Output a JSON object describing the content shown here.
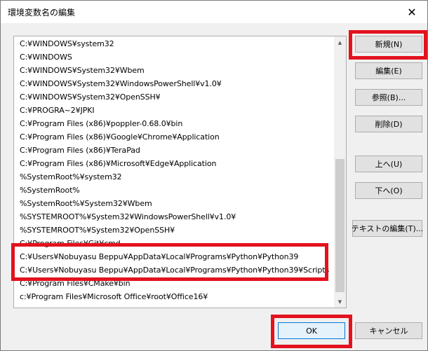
{
  "window": {
    "title": "環境変数名の編集",
    "close_label": "✕"
  },
  "list": {
    "items": [
      "C:¥WINDOWS¥system32",
      "C:¥WINDOWS",
      "C:¥WINDOWS¥System32¥Wbem",
      "C:¥WINDOWS¥System32¥WindowsPowerShell¥v1.0¥",
      "C:¥WINDOWS¥System32¥OpenSSH¥",
      "C:¥PROGRA~2¥JPKI",
      "C:¥Program Files (x86)¥poppler-0.68.0¥bin",
      "C:¥Program Files (x86)¥Google¥Chrome¥Application",
      "C:¥Program Files (x86)¥TeraPad",
      "C:¥Program Files (x86)¥Microsoft¥Edge¥Application",
      "%SystemRoot%¥system32",
      "%SystemRoot%",
      "%SystemRoot%¥System32¥Wbem",
      "%SYSTEMROOT%¥System32¥WindowsPowerShell¥v1.0¥",
      "%SYSTEMROOT%¥System32¥OpenSSH¥",
      "C:¥Program Files¥Git¥cmd",
      "C:¥Users¥Nobuyasu Beppu¥AppData¥Local¥Programs¥Python¥Python39",
      "C:¥Users¥Nobuyasu Beppu¥AppData¥Local¥Programs¥Python¥Python39¥Scripts",
      "C:¥Program Files¥CMake¥bin",
      "c:¥Program Files¥Microsoft Office¥root¥Office16¥"
    ]
  },
  "buttons": {
    "new": "新規(N)",
    "edit": "編集(E)",
    "browse": "参照(B)...",
    "delete": "削除(D)",
    "up": "上へ(U)",
    "down": "下へ(O)",
    "edit_text": "テキストの編集(T)...",
    "ok": "OK",
    "cancel": "キャンセル"
  },
  "colors": {
    "highlight": "#e3121e"
  }
}
